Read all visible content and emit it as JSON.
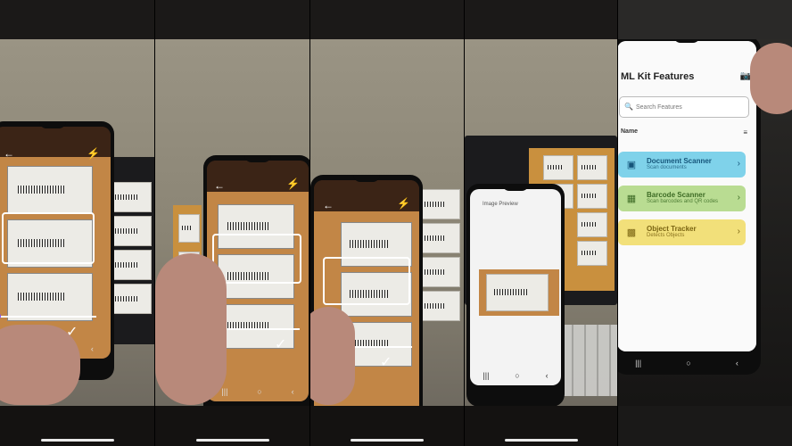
{
  "strip_1": {
    "camera": {
      "back_icon": "arrow-left-icon",
      "flash_icon": "flash-icon",
      "nav": [
        "|||",
        "○",
        "‹"
      ],
      "accept_icon": "check-icon"
    }
  },
  "strip_2": {
    "camera": {
      "back_icon": "arrow-left-icon",
      "flash_icon": "flash-icon",
      "nav": [
        "|||",
        "○",
        "‹"
      ],
      "accept_icon": "check-icon"
    }
  },
  "strip_3": {
    "camera": {
      "back_icon": "arrow-left-icon",
      "flash_icon": "flash-icon",
      "nav": [
        "|||",
        "○",
        "‹"
      ],
      "accept_icon": "check-icon"
    }
  },
  "strip_4": {
    "preview": {
      "title": "Image Preview",
      "nav": [
        "|||",
        "○",
        "‹"
      ]
    }
  },
  "strip_5": {
    "app": {
      "title": "ML Kit Features",
      "camera_icon": "camera-icon",
      "search_placeholder": "Search Features",
      "list_header": "Name",
      "sort_icon": "sort-icon",
      "features": [
        {
          "title": "Document Scanner",
          "subtitle": "Scan documents",
          "icon": "document-scan-icon",
          "color": "#7fd2ea"
        },
        {
          "title": "Barcode Scanner",
          "subtitle": "Scan barcodes and QR codes",
          "icon": "qr-icon",
          "color": "#b9dc92"
        },
        {
          "title": "Object Tracker",
          "subtitle": "Detects Objects",
          "icon": "object-icon",
          "color": "#f2e07a"
        }
      ],
      "nav": [
        "|||",
        "○",
        "‹"
      ]
    }
  }
}
